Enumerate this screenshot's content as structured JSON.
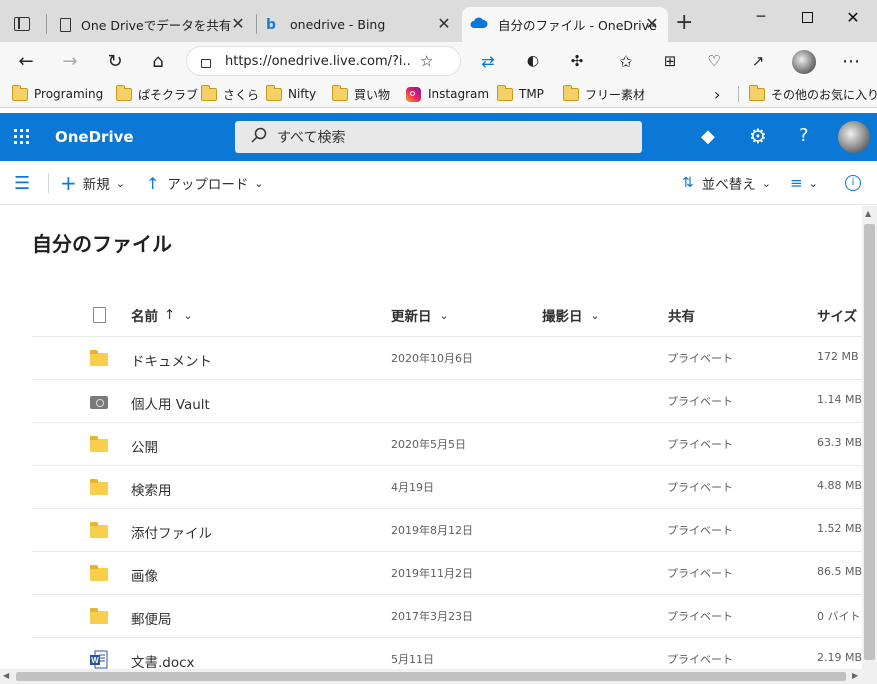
{
  "browser": {
    "tabs": [
      {
        "title": "One Driveでデータを共有する"
      },
      {
        "title": "onedrive - Bing"
      },
      {
        "title": "自分のファイル - OneDrive"
      }
    ],
    "address": "https://onedrive.live.com/?i...",
    "favorites": [
      {
        "label": "Programing",
        "icon": "folder-icon"
      },
      {
        "label": "ぱそクラブ",
        "icon": "folder-icon"
      },
      {
        "label": "さくら",
        "icon": "folder-icon"
      },
      {
        "label": "Nifty",
        "icon": "folder-icon"
      },
      {
        "label": "買い物",
        "icon": "folder-icon"
      },
      {
        "label": "Instagram",
        "icon": "instagram-icon"
      },
      {
        "label": "TMP",
        "icon": "folder-icon"
      },
      {
        "label": "フリー素材",
        "icon": "folder-icon"
      }
    ],
    "other_favorites": "その他のお気に入り"
  },
  "onedrive": {
    "brand": "OneDrive",
    "search_placeholder": "すべて検索",
    "accent": "#0a78d4"
  },
  "commands": {
    "new": "新規",
    "upload": "アップロード",
    "sort": "並べ替え"
  },
  "page_title": "自分のファイル",
  "columns": {
    "name": "名前",
    "name_sort": "↑",
    "modified": "更新日",
    "taken": "撮影日",
    "sharing": "共有",
    "size": "サイズ"
  },
  "files": [
    {
      "icon": "folder-icon",
      "name": "ドキュメント",
      "modified": "2020年10月6日",
      "sharing": "プライベート",
      "size": "172 MB"
    },
    {
      "icon": "vault-icon",
      "name": "個人用 Vault",
      "modified": "",
      "sharing": "プライベート",
      "size": "1.14 MB"
    },
    {
      "icon": "folder-icon",
      "name": "公開",
      "modified": "2020年5月5日",
      "sharing": "プライベート",
      "size": "63.3 MB"
    },
    {
      "icon": "folder-icon",
      "name": "検索用",
      "modified": "4月19日",
      "sharing": "プライベート",
      "size": "4.88 MB"
    },
    {
      "icon": "folder-icon",
      "name": "添付ファイル",
      "modified": "2019年8月12日",
      "sharing": "プライベート",
      "size": "1.52 MB"
    },
    {
      "icon": "folder-icon",
      "name": "画像",
      "modified": "2019年11月2日",
      "sharing": "プライベート",
      "size": "86.5 MB"
    },
    {
      "icon": "folder-icon",
      "name": "郵便局",
      "modified": "2017年3月23日",
      "sharing": "プライベート",
      "size": "0 バイト"
    },
    {
      "icon": "word-doc-icon",
      "name": "文書.docx",
      "modified": "5月11日",
      "sharing": "プライベート",
      "size": "2.19 MB"
    }
  ]
}
